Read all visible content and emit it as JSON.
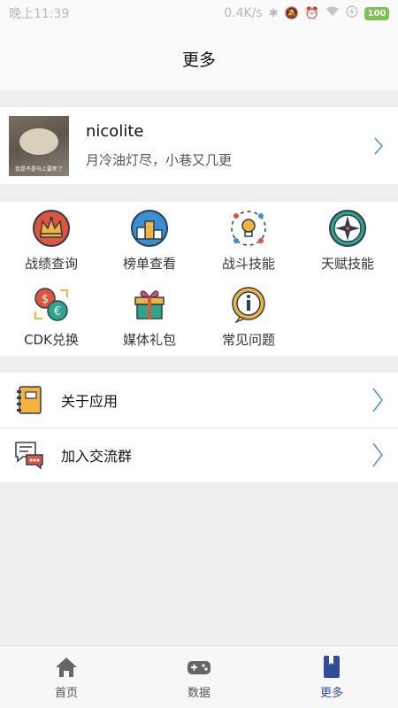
{
  "status_bar": {
    "time": "晚上11:39",
    "speed": "0.4K/s",
    "battery": "100"
  },
  "header": {
    "title": "更多"
  },
  "profile": {
    "avatar_caption": "我是不是马上要死了",
    "username": "nicolite",
    "motto": "月冷油灯尽，小巷又几更"
  },
  "grid": {
    "items": [
      {
        "label": "战绩查询",
        "icon": "crown-icon"
      },
      {
        "label": "榜单查看",
        "icon": "podium-icon"
      },
      {
        "label": "战斗技能",
        "icon": "lightbulb-icon"
      },
      {
        "label": "天赋技能",
        "icon": "compass-icon"
      },
      {
        "label": "CDK兑换",
        "icon": "currency-exchange-icon"
      },
      {
        "label": "媒体礼包",
        "icon": "gift-icon"
      },
      {
        "label": "常见问题",
        "icon": "info-icon"
      }
    ]
  },
  "list": {
    "items": [
      {
        "label": "关于应用",
        "icon": "notebook-icon"
      },
      {
        "label": "加入交流群",
        "icon": "chat-icon"
      }
    ]
  },
  "bottom_nav": {
    "items": [
      {
        "label": "首页",
        "icon": "home-icon"
      },
      {
        "label": "数据",
        "icon": "gamepad-icon"
      },
      {
        "label": "更多",
        "icon": "book-icon",
        "active": true
      }
    ]
  },
  "colors": {
    "accent": "#2f4d9b",
    "chevron": "#4a90d9",
    "battery": "#7cc152"
  }
}
